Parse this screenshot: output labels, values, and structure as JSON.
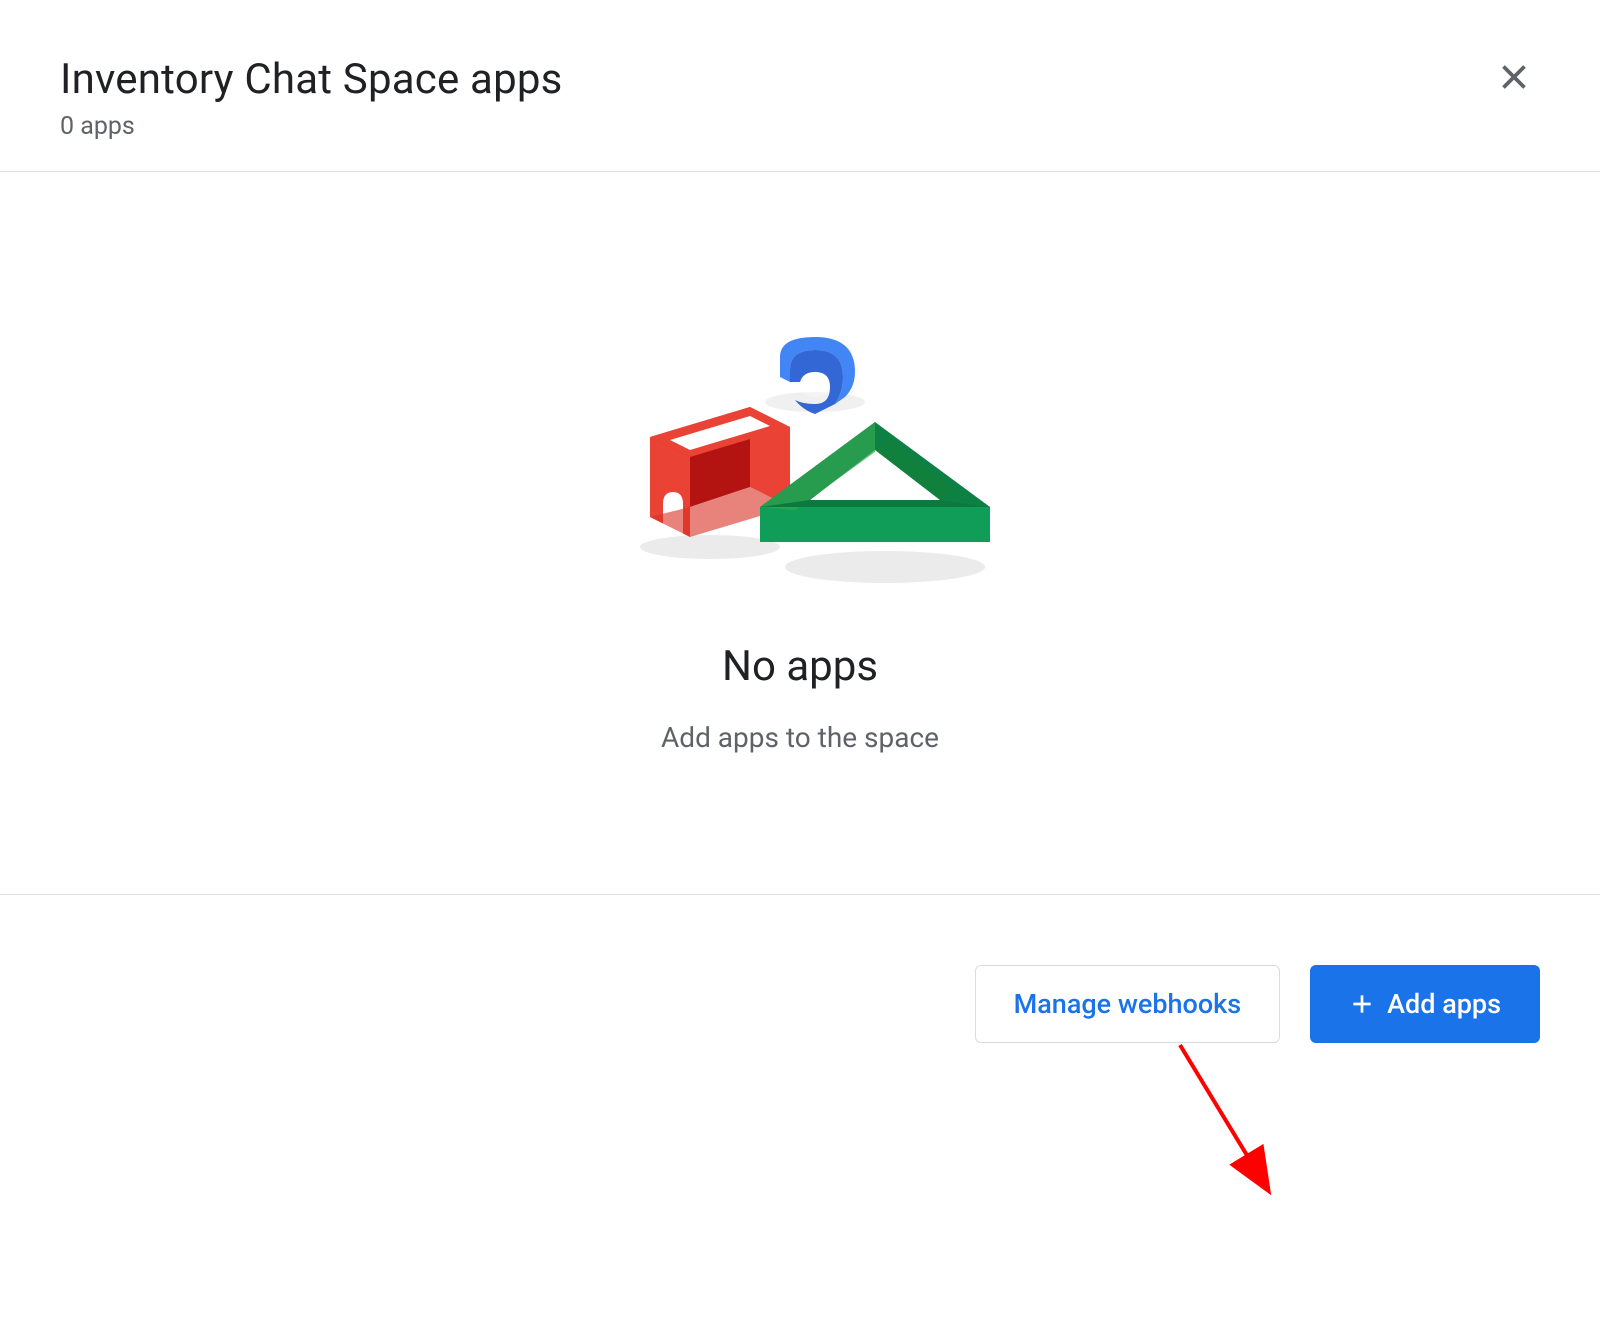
{
  "header": {
    "title": "Inventory Chat Space apps",
    "subtitle": "0 apps"
  },
  "empty_state": {
    "title": "No apps",
    "subtitle": "Add apps to the space"
  },
  "footer": {
    "manage_webhooks_label": "Manage webhooks",
    "add_apps_label": "Add apps"
  },
  "icons": {
    "close": "close-icon",
    "plus": "plus-icon"
  },
  "colors": {
    "primary": "#1a73e8",
    "text_primary": "#202124",
    "text_secondary": "#5f6368",
    "border": "#e0e0e0",
    "red": "#ea4335",
    "green": "#0f9d58",
    "blue": "#4285f4",
    "annotation_red": "#ff0000"
  }
}
